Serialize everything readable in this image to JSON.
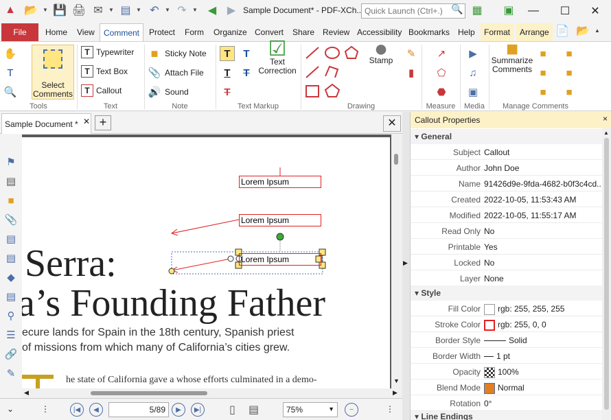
{
  "window": {
    "title": "Sample Document* - PDF-XCh...",
    "quick_launch_placeholder": "Quick Launch (Ctrl+.)"
  },
  "tabs": [
    {
      "label": "File"
    },
    {
      "label": "Home"
    },
    {
      "label": "View"
    },
    {
      "label": "Comment"
    },
    {
      "label": "Protect"
    },
    {
      "label": "Form"
    },
    {
      "label": "Organize"
    },
    {
      "label": "Convert"
    },
    {
      "label": "Share"
    },
    {
      "label": "Review"
    },
    {
      "label": "Accessibility"
    },
    {
      "label": "Bookmarks"
    },
    {
      "label": "Help"
    },
    {
      "label": "Format"
    },
    {
      "label": "Arrange"
    }
  ],
  "ribbon": {
    "tools": {
      "select_comments": "Select Comments",
      "group": "Tools"
    },
    "text": {
      "typewriter": "Typewriter",
      "text_box": "Text Box",
      "callout": "Callout",
      "group": "Text"
    },
    "note": {
      "sticky_note": "Sticky Note",
      "attach_file": "Attach File",
      "sound": "Sound",
      "group": "Note"
    },
    "markup": {
      "text_correction": "Text Correction",
      "group": "Text Markup"
    },
    "drawing": {
      "stamp": "Stamp",
      "group": "Drawing"
    },
    "measure": {
      "group": "Measure"
    },
    "media": {
      "group": "Media"
    },
    "manage": {
      "summarize": "Summarize Comments",
      "group": "Manage Comments"
    }
  },
  "doc_tab": {
    "label": "Sample Document *"
  },
  "page": {
    "heading1": "Serra:",
    "heading2": "a’s Founding Father",
    "line1": "ecure lands for Spain in the 18th century, Spanish priest",
    "line2": "of missions from which many of California’s cities grew.",
    "line3": "he state of California gave a    whose efforts culminated in a demo-",
    "callout1": "Lorem Ipsum",
    "callout2": "Lorem Ipsum",
    "callout3": "Lorem Ipsum"
  },
  "bottom": {
    "page_display": "5/89",
    "zoom": "75%"
  },
  "panel": {
    "title": "Callout Properties",
    "general_label": "General",
    "general": [
      {
        "label": "Subject",
        "value": "Callout"
      },
      {
        "label": "Author",
        "value": "John Doe"
      },
      {
        "label": "Name",
        "value": "91426d9e-9fda-4682-b0f3c4cd..."
      },
      {
        "label": "Created",
        "value": "2022-10-05, 11:53:43 AM"
      },
      {
        "label": "Modified",
        "value": "2022-10-05, 11:55:17 AM"
      },
      {
        "label": "Read Only",
        "value": "No"
      },
      {
        "label": "Printable",
        "value": "Yes"
      },
      {
        "label": "Locked",
        "value": "No"
      },
      {
        "label": "Layer",
        "value": "None"
      }
    ],
    "style_label": "Style",
    "style": [
      {
        "label": "Fill Color",
        "value": "rgb: 255, 255, 255"
      },
      {
        "label": "Stroke Color",
        "value": "rgb: 255, 0, 0"
      },
      {
        "label": "Border Style",
        "value": "Solid"
      },
      {
        "label": "Border Width",
        "value": "1 pt"
      },
      {
        "label": "Opacity",
        "value": "100%"
      },
      {
        "label": "Blend Mode",
        "value": "Normal"
      },
      {
        "label": "Rotation",
        "value": "0°"
      }
    ],
    "line_endings_label": "Line Endings"
  },
  "colors": {
    "file_tab": "#c8373b",
    "accent": "#1a4e9b",
    "format_tab": "#fdf1c8",
    "callout_stroke": "#e02020"
  }
}
